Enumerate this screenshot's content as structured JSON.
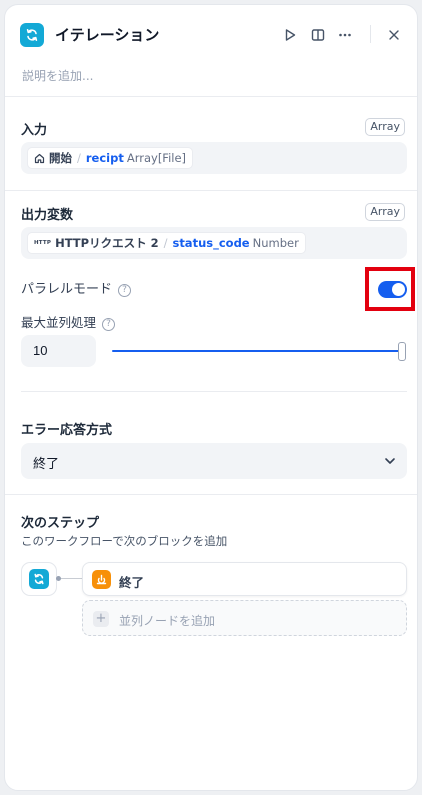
{
  "header": {
    "title": "イテレーション",
    "description_placeholder": "説明を追加..."
  },
  "input": {
    "label": "入力",
    "type": "Array",
    "source": "開始",
    "variable": "recipt",
    "var_type": "Array[File]"
  },
  "output": {
    "label": "出力変数",
    "type": "Array",
    "source_tag": "HTTP",
    "source": "HTTPリクエスト 2",
    "variable": "status_code",
    "var_type": "Number"
  },
  "parallel": {
    "label": "パラレルモード",
    "enabled": true,
    "max_label": "最大並列処理",
    "max_value": "10",
    "slider_fraction": 1.0
  },
  "error": {
    "label": "エラー応答方式",
    "selected": "終了"
  },
  "next_step": {
    "label": "次のステップ",
    "subtitle": "このワークフローで次のブロックを追加",
    "next_node": "終了",
    "add_parallel": "並列ノードを追加"
  },
  "colors": {
    "accent": "#155eef",
    "iteration_icon": "#13a9d6",
    "end_icon": "#f79009",
    "highlight": "#e3000f"
  },
  "icons": [
    "iteration-icon",
    "play-icon",
    "split-view-icon",
    "more-icon",
    "close-icon",
    "home-icon",
    "help-icon",
    "chevron-down-icon",
    "end-icon",
    "plus-icon"
  ]
}
